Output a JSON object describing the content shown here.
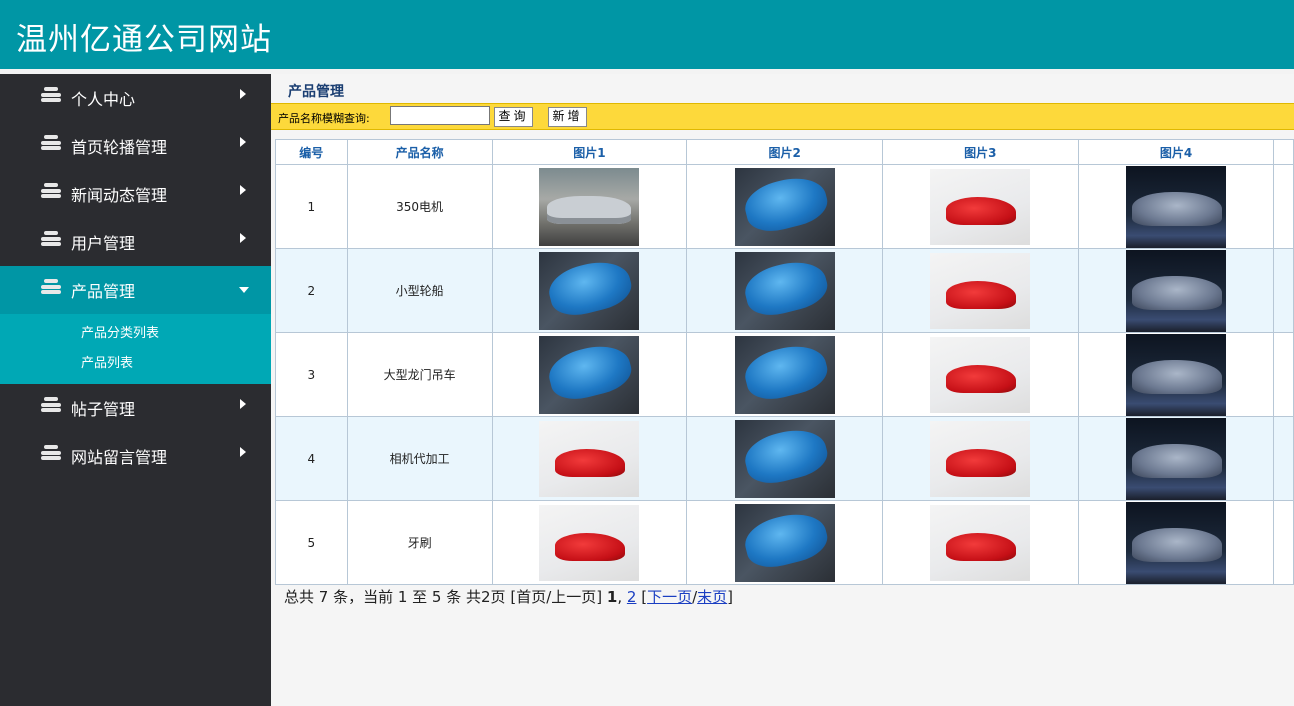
{
  "site": {
    "title": "温州亿通公司网站"
  },
  "sidebar": {
    "items": [
      {
        "label": "个人中心"
      },
      {
        "label": "首页轮播管理"
      },
      {
        "label": "新闻动态管理"
      },
      {
        "label": "用户管理"
      },
      {
        "label": "产品管理",
        "submenu": [
          "产品分类列表",
          "产品列表"
        ]
      },
      {
        "label": "帖子管理"
      },
      {
        "label": "网站留言管理"
      }
    ],
    "icon": "stack-icon",
    "active_index": 4
  },
  "main": {
    "page_title": "产品管理",
    "search": {
      "label": "产品名称模糊查询:",
      "value": "",
      "query_button": "查询",
      "add_button": "新增"
    },
    "table": {
      "headers": [
        "编号",
        "产品名称",
        "图片1",
        "图片2",
        "图片3",
        "图片4"
      ],
      "rows": [
        {
          "id": "1",
          "name": "350电机",
          "images": [
            "silver-car-photo",
            "blue-car-photo",
            "red-car-photo",
            "gray-car-photo"
          ]
        },
        {
          "id": "2",
          "name": "小型轮船",
          "images": [
            "blue-car-photo",
            "blue-car-photo",
            "red-car-photo",
            "gray-car-photo"
          ]
        },
        {
          "id": "3",
          "name": "大型龙门吊车",
          "images": [
            "blue-car-photo",
            "blue-car-photo",
            "red-car-photo",
            "gray-car-photo"
          ]
        },
        {
          "id": "4",
          "name": "相机代加工",
          "images": [
            "red-car-photo",
            "blue-car-photo",
            "red-car-photo",
            "gray-car-photo"
          ]
        },
        {
          "id": "5",
          "name": "牙刷",
          "images": [
            "red-car-photo",
            "blue-car-photo",
            "red-car-photo",
            "gray-car-photo"
          ]
        }
      ]
    },
    "pager": {
      "summary": "总共 7 条，当前 1 至 5 条 共2页",
      "first_prev": "[首页/上一页]",
      "current_page": "1",
      "sep": ",",
      "page_2": "2",
      "lbracket": "[",
      "next": "下一页",
      "slash": "/",
      "last": "末页",
      "rbracket": "]"
    }
  },
  "colors": {
    "header": "#0096a5",
    "sidebar": "#2b2c30",
    "submenu": "#00a8b5",
    "searchbar": "#fdd93b",
    "alt_row": "#eaf6fd"
  }
}
